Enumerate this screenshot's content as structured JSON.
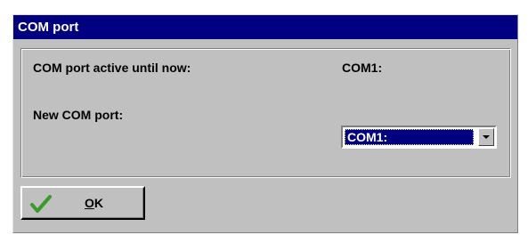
{
  "window": {
    "title": "COM port"
  },
  "form": {
    "active_label": "COM port active until now:",
    "active_value": "COM1:",
    "new_label": "New COM port:",
    "new_value": "COM1:"
  },
  "buttons": {
    "ok_mnemonic": "O",
    "ok_rest": "K"
  },
  "icons": {
    "ok_icon": "check-icon",
    "dropdown_icon": "chevron-down-icon"
  },
  "colors": {
    "titlebar": "#000080",
    "window_face": "#c0c0c0",
    "selection": "#000080",
    "check": "#3a9a2a"
  }
}
